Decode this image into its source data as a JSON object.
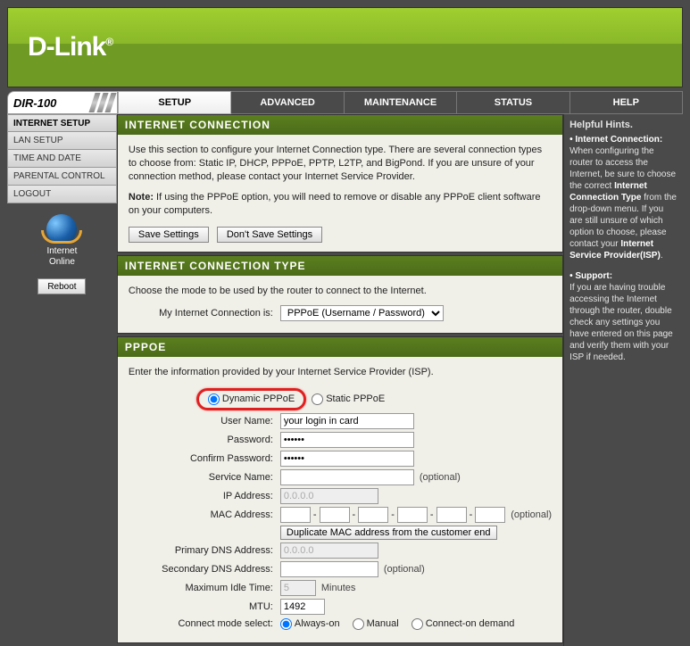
{
  "brand": "D-Link",
  "model": "DIR-100",
  "tabs": {
    "setup": "SETUP",
    "advanced": "ADVANCED",
    "maintenance": "MAINTENANCE",
    "status": "STATUS",
    "help": "HELP"
  },
  "sidebar": {
    "items": [
      {
        "label": "INTERNET SETUP"
      },
      {
        "label": "LAN SETUP"
      },
      {
        "label": "TIME AND DATE"
      },
      {
        "label": "PARENTAL CONTROL"
      },
      {
        "label": "LOGOUT"
      }
    ],
    "status1": "Internet",
    "status2": "Online",
    "reboot": "Reboot"
  },
  "section1": {
    "title": "INTERNET CONNECTION",
    "body": "Use this section to configure your Internet Connection type. There are several connection types to choose from: Static IP, DHCP, PPPoE, PPTP, L2TP, and BigPond. If you are unsure of your connection method, please contact your Internet Service Provider.",
    "note_label": "Note:",
    "note": " If using the PPPoE option, you will need to remove or disable any PPPoE client software on your computers.",
    "save": "Save Settings",
    "dont": "Don't Save Settings"
  },
  "section2": {
    "title": "INTERNET CONNECTION TYPE",
    "body": "Choose the mode to be used by the router to connect to the Internet.",
    "label": "My Internet Connection is:",
    "value": "PPPoE (Username / Password)"
  },
  "pppoe": {
    "title": "PPPOE",
    "intro": "Enter the information provided by your Internet Service Provider (ISP).",
    "dynamic": "Dynamic PPPoE",
    "static": "Static PPPoE",
    "username_lbl": "User Name:",
    "username_val": "your login in card",
    "password_lbl": "Password:",
    "password_val": "••••••",
    "confirm_lbl": "Confirm Password:",
    "confirm_val": "••••••",
    "service_lbl": "Service Name:",
    "ip_lbl": "IP Address:",
    "ip_val": "0.0.0.0",
    "mac_lbl": "MAC Address:",
    "mac_btn": "Duplicate MAC address from the customer end",
    "pdns_lbl": "Primary DNS Address:",
    "pdns_val": "0.0.0.0",
    "sdns_lbl": "Secondary DNS Address:",
    "idle_lbl": "Maximum Idle Time:",
    "idle_val": "5",
    "idle_unit": "Minutes",
    "mtu_lbl": "MTU:",
    "mtu_val": "1492",
    "mode_lbl": "Connect mode select:",
    "mode_always": "Always-on",
    "mode_manual": "Manual",
    "mode_demand": "Connect-on demand",
    "optional": "(optional)"
  },
  "hints": {
    "title": "Helpful Hints.",
    "p1a": "• Internet Connection:",
    "p1b": "When configuring the router to access the Internet, be sure to choose the correct ",
    "p1c": "Internet Connection Type",
    "p1d": " from the drop-down menu. If you are still unsure of which option to choose, please contact your ",
    "p1e": "Internet Service Provider(ISP)",
    "p1f": ".",
    "p2a": "• Support:",
    "p2b": "If you are having trouble accessing the Internet through the router, double check any settings you have entered on this page and verify them with your ISP if needed."
  }
}
